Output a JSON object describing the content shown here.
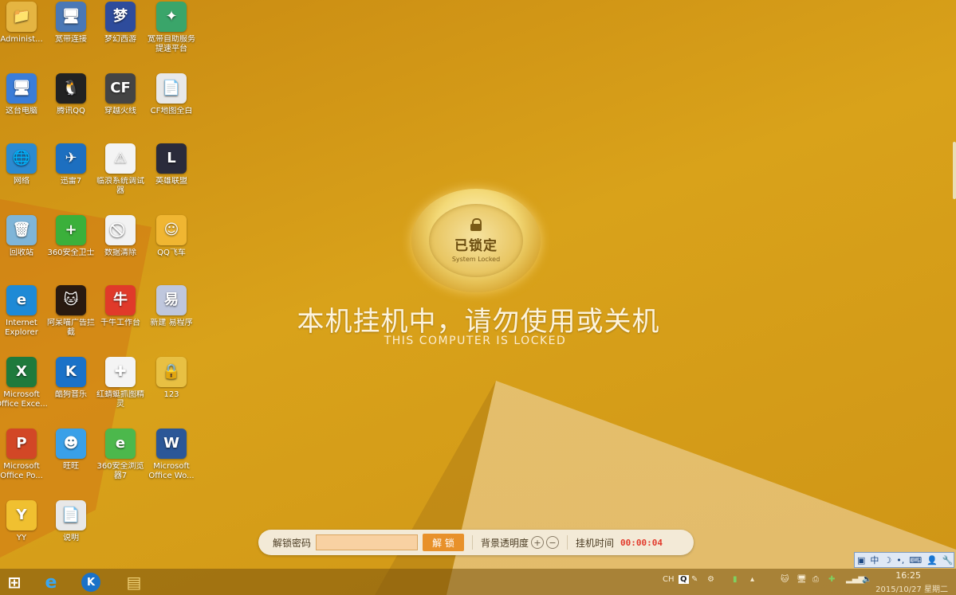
{
  "desktop_icons": [
    {
      "label": "Administ...",
      "icon": "folder-user-icon",
      "bg": "#e5b542",
      "glyph": "📁"
    },
    {
      "label": "宽带连接",
      "icon": "network-connection-icon",
      "bg": "#4a78b6",
      "glyph": "🖥"
    },
    {
      "label": "梦幻西游",
      "icon": "game-menghuan-icon",
      "bg": "#2e4c9c",
      "glyph": "梦"
    },
    {
      "label": "宽带自助服务提速平台",
      "icon": "speed-platform-icon",
      "bg": "#3aa56a",
      "glyph": "✦"
    },
    {
      "label": "这台电脑",
      "icon": "this-pc-icon",
      "bg": "#3b7dd8",
      "glyph": "🖥"
    },
    {
      "label": "腾讯QQ",
      "icon": "qq-penguin-icon",
      "bg": "#222",
      "glyph": "🐧"
    },
    {
      "label": "穿越火线",
      "icon": "crossfire-icon",
      "bg": "#444",
      "glyph": "CF"
    },
    {
      "label": "CF地图全白",
      "icon": "document-icon",
      "bg": "#e8e8e8",
      "glyph": "📄"
    },
    {
      "label": "网络",
      "icon": "network-globe-icon",
      "bg": "#2c8ad0",
      "glyph": "🌐"
    },
    {
      "label": "迅雷7",
      "icon": "xunlei-bird-icon",
      "bg": "#1d6fc0",
      "glyph": "✈"
    },
    {
      "label": "临浪系统调试器",
      "icon": "warning-triangle-icon",
      "bg": "#f4f4f4",
      "glyph": "⚠"
    },
    {
      "label": "英雄联盟",
      "icon": "lol-icon",
      "bg": "#2a2b3b",
      "glyph": "L"
    },
    {
      "label": "回收站",
      "icon": "recycle-bin-icon",
      "bg": "#7fb5d8",
      "glyph": "🗑"
    },
    {
      "label": "360安全卫士",
      "icon": "shield-360-icon",
      "bg": "#3bb03b",
      "glyph": "+"
    },
    {
      "label": "数据清除",
      "icon": "no-sign-icon",
      "bg": "#f2f2f2",
      "glyph": "⃠"
    },
    {
      "label": "QQ飞车",
      "icon": "qq-speed-icon",
      "bg": "#f0b632",
      "glyph": "☺"
    },
    {
      "label": "Internet Explorer",
      "icon": "ie-icon",
      "bg": "#1e8ad6",
      "glyph": "e"
    },
    {
      "label": "阿呆喵广告拦截",
      "icon": "cat-adblock-icon",
      "bg": "#2a1a10",
      "glyph": "🐱"
    },
    {
      "label": "千牛工作台",
      "icon": "qianniu-icon",
      "bg": "#e03a2a",
      "glyph": "牛"
    },
    {
      "label": "新建 易程序",
      "icon": "epl-file-icon",
      "bg": "#bfc7dd",
      "glyph": "易"
    },
    {
      "label": "Microsoft Office Exce...",
      "icon": "excel-icon",
      "bg": "#1f7a3c",
      "glyph": "X"
    },
    {
      "label": "酷狗音乐",
      "icon": "kugou-icon",
      "bg": "#1b72c8",
      "glyph": "K"
    },
    {
      "label": "红蜻蜓抓图精灵",
      "icon": "dragonfly-icon",
      "bg": "#f4f4f4",
      "glyph": "✚"
    },
    {
      "label": "123",
      "icon": "lock-folder-icon",
      "bg": "#e8c043",
      "glyph": "🔒"
    },
    {
      "label": "Microsoft Office Po...",
      "icon": "powerpoint-icon",
      "bg": "#d24726",
      "glyph": "P"
    },
    {
      "label": "旺旺",
      "icon": "wangwang-icon",
      "bg": "#3aa0e8",
      "glyph": "☻"
    },
    {
      "label": "360安全浏览器7",
      "icon": "browser-360-icon",
      "bg": "#4cb84c",
      "glyph": "e"
    },
    {
      "label": "Microsoft Office Wo...",
      "icon": "word-icon",
      "bg": "#2b5797",
      "glyph": "W"
    },
    {
      "label": "YY",
      "icon": "yy-icon",
      "bg": "#f0c030",
      "glyph": "Y"
    },
    {
      "label": "说明",
      "icon": "document-icon",
      "bg": "#e8e8e8",
      "glyph": "📄"
    }
  ],
  "lock": {
    "badge_cn": "已锁定",
    "badge_en": "System Locked",
    "title": "本机挂机中，请勿使用或关机",
    "subtitle": "THIS COMPUTER IS LOCKED"
  },
  "unlock_bar": {
    "password_label": "解锁密码",
    "password_value": "",
    "unlock_button": "解 锁",
    "opacity_label": "背景透明度",
    "plus": "+",
    "minus": "−",
    "idle_label": "挂机时间",
    "idle_time": "00:00:04"
  },
  "ime": {
    "items": [
      "中",
      "☽",
      "•,",
      "⌨",
      "👤",
      "🔧"
    ]
  },
  "taskbar": {
    "pinned": [
      {
        "icon": "windows-start-icon",
        "glyph": "⊞"
      },
      {
        "icon": "ie-icon",
        "glyph": "e"
      },
      {
        "icon": "kugou-icon",
        "glyph": "K"
      },
      {
        "icon": "file-explorer-icon",
        "glyph": "▤"
      }
    ],
    "tray_lang": "CH",
    "clock_time": "16:25",
    "clock_date": "2015/10/27 星期二"
  },
  "colors": {
    "accent": "#e8912a",
    "idle_time": "#e2392b"
  }
}
